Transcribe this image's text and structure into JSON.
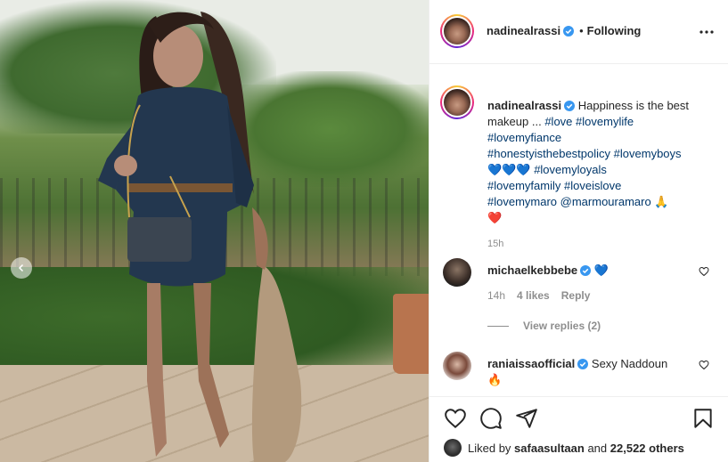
{
  "post": {
    "author": "nadinealrassi",
    "follow_state": "Following",
    "separator": "•"
  },
  "caption": {
    "username": "nadinealrassi",
    "text_plain": "Happiness is the best makeup ...",
    "hashtags_line1": [
      "#love",
      "#lovemylife"
    ],
    "hashtags_line2": [
      "#lovemyfiance"
    ],
    "hashtags_line3": [
      "#honestyisthebestpolicy",
      "#lovemyboys"
    ],
    "emoji_blue_hearts": "💙💙💙",
    "hashtags_line4": [
      "#lovemyloyals"
    ],
    "hashtags_line5": [
      "#lovemyfamily",
      "#loveislove"
    ],
    "hashtags_line6": [
      "#lovemymaro"
    ],
    "mention": "@marmouramaro",
    "emoji_pray": "🙏",
    "emoji_red_heart": "❤️",
    "time": "15h"
  },
  "comments": [
    {
      "username": "michaelkebbebe",
      "text": "💙",
      "time": "14h",
      "likes": "4 likes",
      "reply_label": "Reply",
      "view_replies": "View replies (2)"
    },
    {
      "username": "raniaissaofficial",
      "text": "Sexy Naddoun",
      "emoji": "🔥"
    }
  ],
  "likes": {
    "prefix": "Liked by",
    "user": "safaasultaan",
    "conjunction": "and",
    "others": "22,522 others"
  },
  "colors": {
    "text": "#262626",
    "secondary": "#8e8e8e",
    "link": "#00376b",
    "verified": "#3897f0",
    "border": "#efefef"
  },
  "icons": {
    "verified": "verified-badge-icon",
    "more": "more-options-icon",
    "like": "heart-icon",
    "comment": "comment-icon",
    "share": "paper-plane-icon",
    "save": "bookmark-icon",
    "prev": "chevron-left-icon"
  }
}
